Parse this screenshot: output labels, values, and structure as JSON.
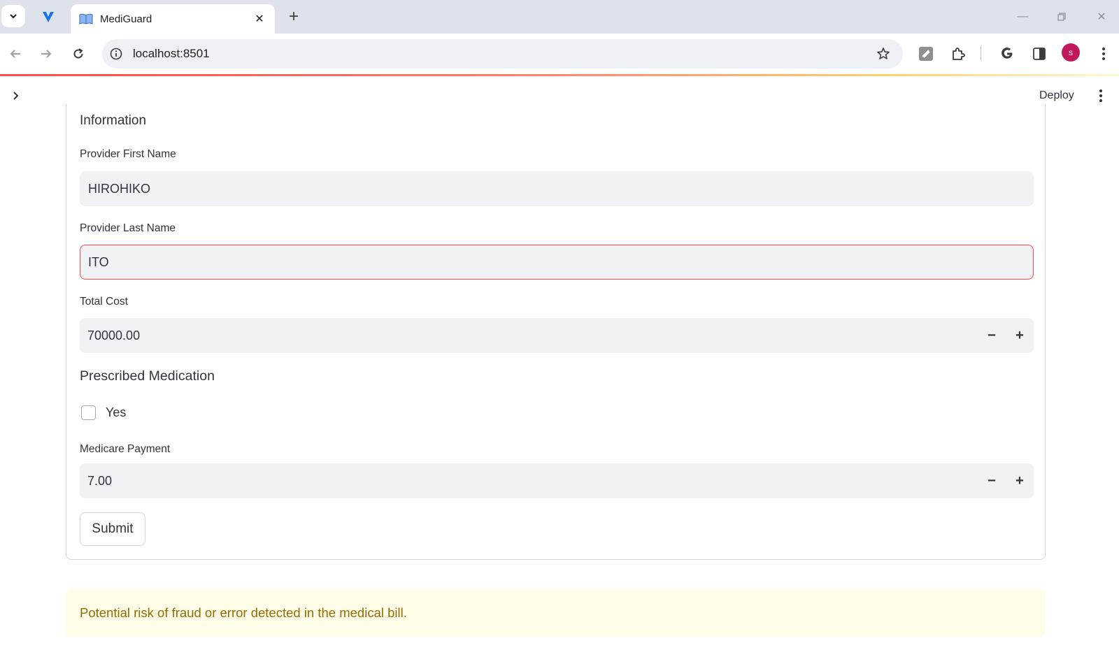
{
  "browser": {
    "tab_title": "MediGuard",
    "url": "localhost:8501",
    "profile_initial": "s"
  },
  "app_header": {
    "deploy_label": "Deploy"
  },
  "form": {
    "section_title": "Information",
    "provider_first_name": {
      "label": "Provider First Name",
      "value": "HIROHIKO"
    },
    "provider_last_name": {
      "label": "Provider Last Name",
      "value": "ITO"
    },
    "total_cost": {
      "label": "Total Cost",
      "value": "70000.00"
    },
    "prescribed_medication": {
      "title": "Prescribed Medication",
      "checkbox_label": "Yes",
      "checked": false
    },
    "medicare_payment": {
      "label": "Medicare Payment",
      "value": "7.00"
    },
    "submit_label": "Submit"
  },
  "alert": {
    "message": "Potential risk of fraud or error detected in the medical bill."
  },
  "colors": {
    "accent": "#ff4b4b",
    "warning_bg": "#fffce7",
    "warning_text": "#926c05",
    "input_bg": "#f0f2f6"
  }
}
